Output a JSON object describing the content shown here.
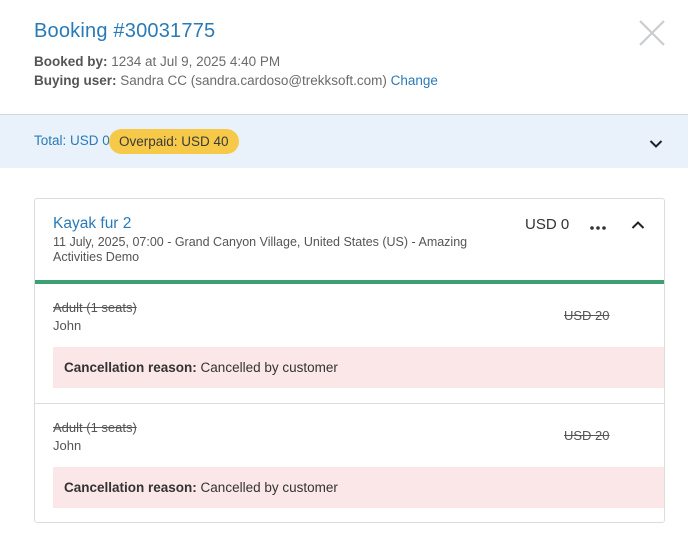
{
  "booking": {
    "title": "Booking #30031775",
    "booked_by_label": "Booked by:",
    "booked_by_value": " 1234 at Jul 9, 2025 4:40 PM",
    "buying_user_label": "Buying user:",
    "buying_user_value": " Sandra CC (sandra.cardoso@trekksoft.com) ",
    "change_link": "Change"
  },
  "totals": {
    "total_text": "Total: USD 0",
    "overpaid_badge": "Overpaid: USD 40"
  },
  "card": {
    "title": "Kayak fur 2",
    "subtitle": "11 July, 2025, 07:00 - Grand Canyon Village, United States (US) - Amazing Activities Demo",
    "price": "USD 0",
    "rows": [
      {
        "label": "Adult (1 seats)",
        "name": "John",
        "price": "USD 20",
        "cancel_label": "Cancellation reason:",
        "cancel_reason": " Cancelled by customer"
      },
      {
        "label": "Adult (1 seats)",
        "name": "John",
        "price": "USD 20",
        "cancel_label": "Cancellation reason:",
        "cancel_reason": " Cancelled by customer"
      }
    ]
  },
  "icons": {
    "close": "close-icon",
    "totals_toggle": "chevron-down-icon",
    "more": "more-horizontal-icon",
    "collapse": "chevron-up-icon"
  },
  "colors": {
    "accent": "#2a7ab8",
    "badge": "#f7c948",
    "success_bar": "#3ca073",
    "cancel_bg": "#fbe7e7",
    "totals_bg": "#e9f2fa"
  }
}
